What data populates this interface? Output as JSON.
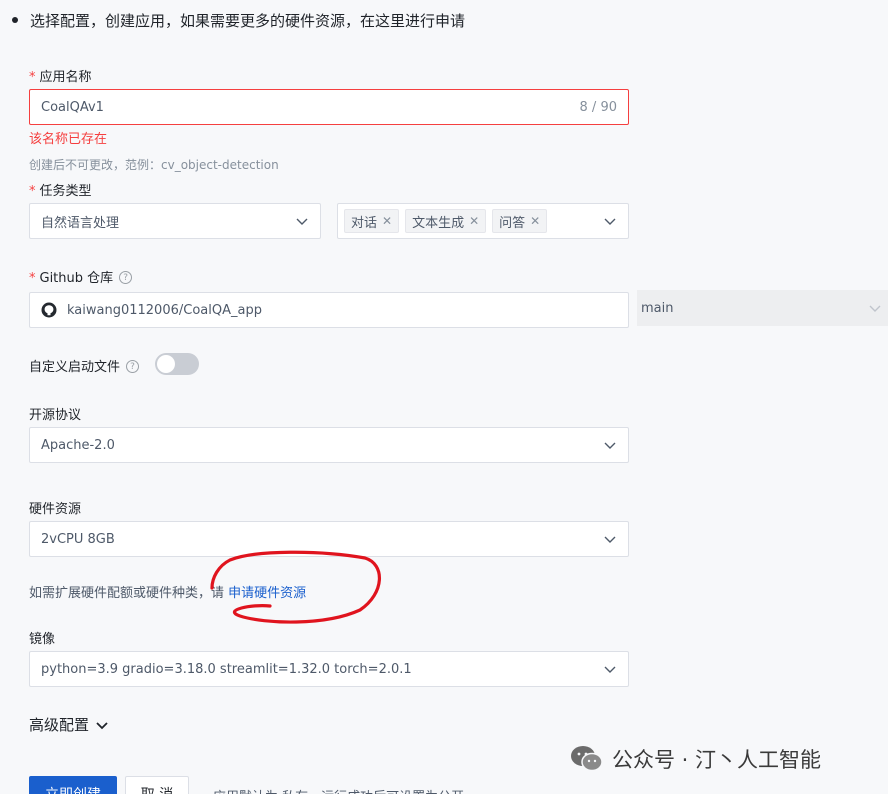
{
  "intro": "选择配置，创建应用，如果需要更多的硬件资源，在这里进行申请",
  "app_name": {
    "label": "应用名称",
    "value": "CoalQAv1",
    "counter": "8 / 90",
    "error": "该名称已存在",
    "hint": "创建后不可更改，范例：cv_object-detection"
  },
  "task_type": {
    "label": "任务类型",
    "value": "自然语言处理",
    "tags": [
      "对话",
      "文本生成",
      "问答"
    ]
  },
  "github": {
    "label": "Github 仓库",
    "repo": "kaiwang0112006/CoalQA_app",
    "branch": "main"
  },
  "custom_start": {
    "label": "自定义启动文件",
    "enabled": false
  },
  "license": {
    "label": "开源协议",
    "value": "Apache-2.0"
  },
  "hardware": {
    "label": "硬件资源",
    "value": "2vCPU 8GB",
    "note_prefix": "如需扩展硬件配额或硬件种类，请",
    "note_link": "申请硬件资源"
  },
  "image": {
    "label": "镜像",
    "value": "python=3.9 gradio=3.18.0 streamlit=1.32.0 torch=2.0.1"
  },
  "advanced": {
    "label": "高级配置"
  },
  "actions": {
    "create": "立即创建",
    "cancel": "取 消",
    "note": "应用默认为 私有，运行成功后可设置为公开"
  },
  "watermark": "公众号 · 汀丶人工智能",
  "colors": {
    "primary": "#1a5fcd",
    "error": "#f53f3f",
    "annotation": "#e0141e"
  }
}
